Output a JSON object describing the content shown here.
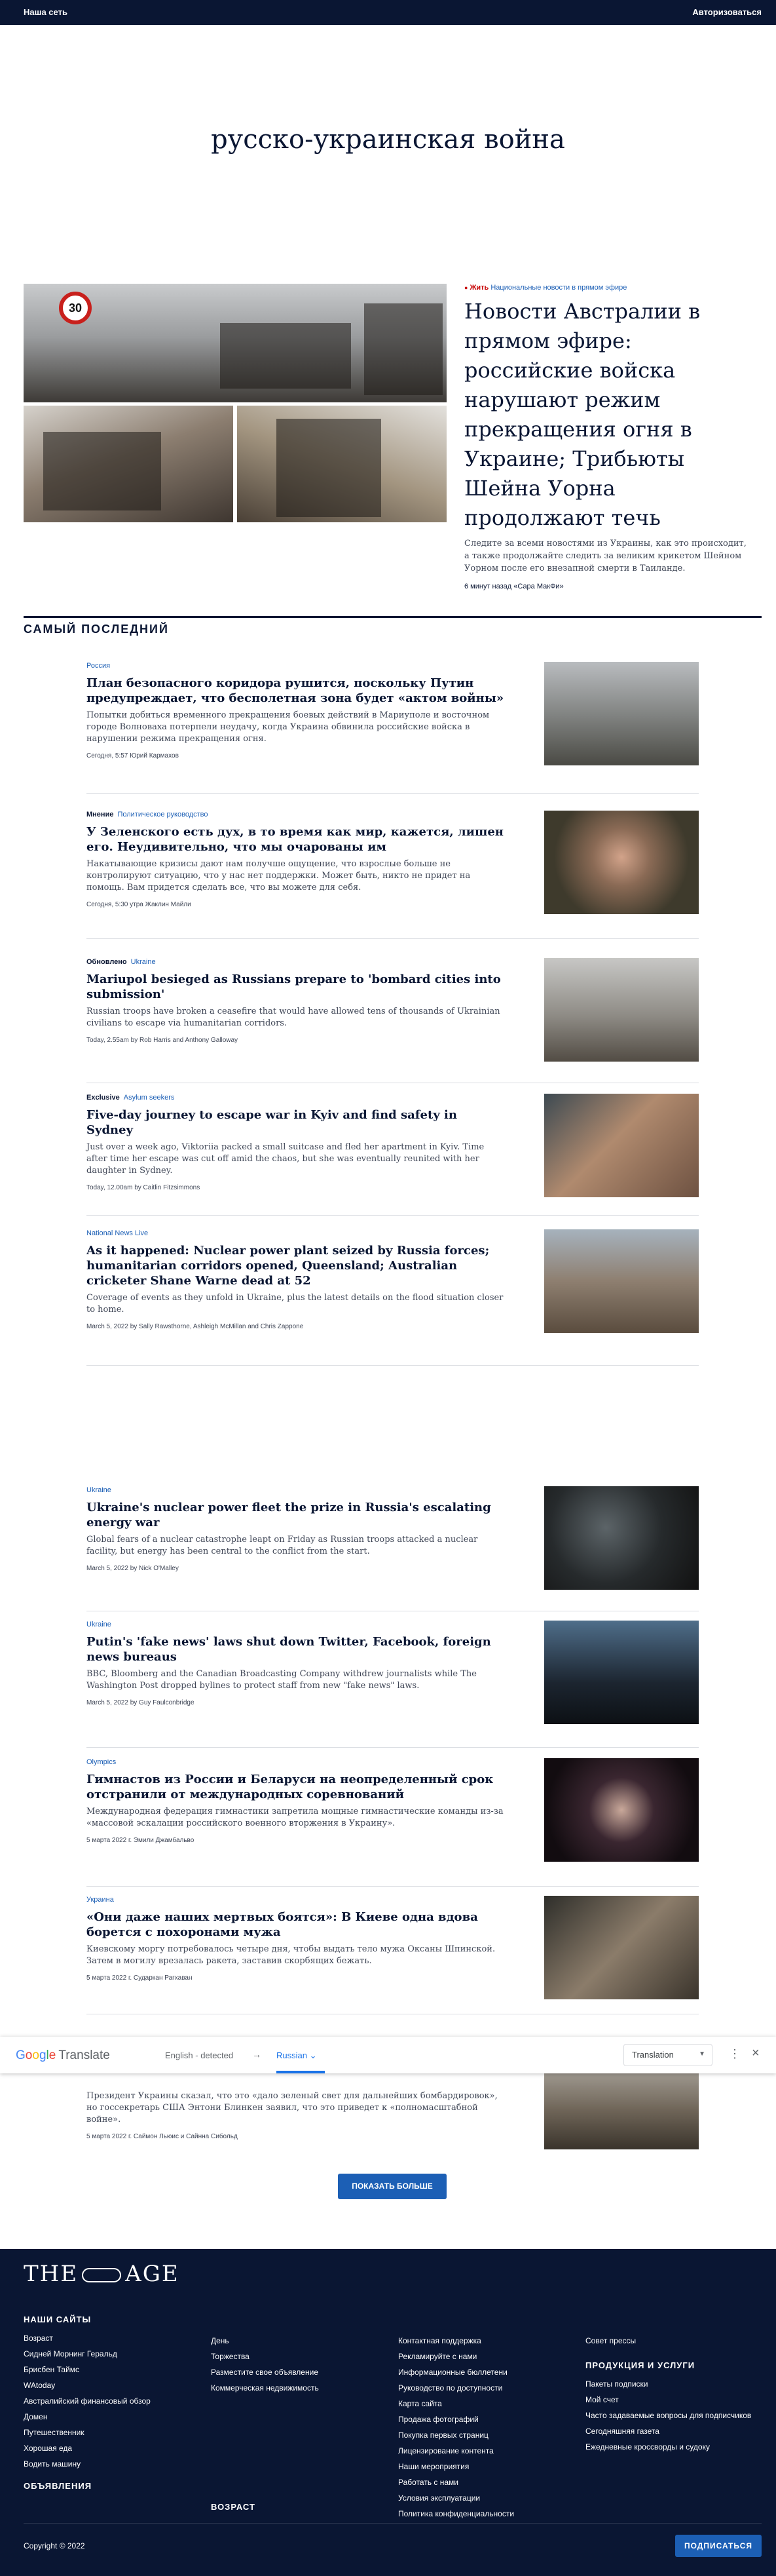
{
  "topbar": {
    "network": "Наша сеть",
    "login": "Авторизоваться"
  },
  "page_title": "русско-украинская война",
  "hero": {
    "tag_live": "Жить",
    "tag_section": "Национальные новости в прямом эфире",
    "headline": "Новости Австралии в прямом эфире: российские войска нарушают режим прекращения огня в Украине; Трибьюты Шейна Уорна продолжают течь",
    "summary": "Следите за всеми новостями из Украины, как это происходит, а также продолжайте следить за великим крикетом Шейном Уорном после его внезапной смерти в Таиланде.",
    "meta": "6 минут назад «Сара МакФи»",
    "sign_text": "30"
  },
  "latest_heading": "САМЫЙ ПОСЛЕДНИЙ",
  "stories": [
    {
      "label": "",
      "section": "Россия",
      "headline": "План безопасного коридора рушится, поскольку Путин предупреждает, что бесполетная зона будет «актом войны»",
      "summary": "Попытки добиться временного прекращения боевых действий в Мариуполе и восточном городе Волноваха потерпели неудачу, когда Украина обвинила российские войска в нарушении режима прекращения огня.",
      "meta": "Сегодня, 5:57 Юрий Кармахов"
    },
    {
      "label": "Мнение",
      "section": "Политическое руководство",
      "headline": "У Зеленского есть дух, в то время как мир, кажется, лишен его. Неудивительно, что мы очарованы им",
      "summary": "Накатывающие кризисы дают нам получше ощущение, что взрослые больше не контролируют ситуацию, что у нас нет поддержки. Может быть, никто не придет на помощь. Вам придется сделать все, что вы можете для себя.",
      "meta": "Сегодня, 5:30 утра Жаклин Майли"
    },
    {
      "label": "Обновлено",
      "section": "Ukraine",
      "headline": "Mariupol besieged as Russians prepare to 'bombard cities into submission'",
      "summary": "Russian troops have broken a ceasefire that would have allowed tens of thousands of Ukrainian civilians to escape via humanitarian corridors.",
      "meta": "Today, 2.55am by Rob Harris and Anthony Galloway"
    },
    {
      "label": "Exclusive",
      "section": "Asylum seekers",
      "headline": "Five-day journey to escape war in Kyiv and find safety in Sydney",
      "summary": "Just over a week ago, Viktoriia packed a small suitcase and fled her apartment in Kyiv. Time after time her escape was cut off amid the chaos, but she was eventually reunited with her daughter in Sydney.",
      "meta": "Today, 12.00am by Caitlin Fitzsimmons"
    },
    {
      "label": "",
      "section": "National News Live",
      "headline": "As it happened: Nuclear power plant seized by Russia forces; humanitarian corridors opened, Queensland; Australian cricketer Shane Warne dead at 52",
      "summary": "Coverage of events as they unfold in Ukraine, plus the latest details on the flood situation closer to home.",
      "meta": "March 5, 2022 by Sally Rawsthorne, Ashleigh McMillan and Chris Zappone"
    },
    {
      "label": "",
      "section": "Ukraine",
      "headline": "Ukraine's nuclear power fleet the prize in Russia's escalating energy war",
      "summary": "Global fears of a nuclear catastrophe leapt on Friday as Russian troops attacked a nuclear facility, but energy has been central to the conflict from the start.",
      "meta": "March 5, 2022 by Nick O'Malley"
    },
    {
      "label": "",
      "section": "Ukraine",
      "headline": "Putin's 'fake news' laws shut down Twitter, Facebook, foreign news bureaus",
      "summary": "BBC, Bloomberg and the Canadian Broadcasting Company withdrew journalists while The Washington Post dropped bylines to protect staff from new \"fake news\" laws.",
      "meta": "March 5, 2022 by Guy Faulconbridge"
    },
    {
      "label": "",
      "section": "Olympics",
      "headline": "Гимнастов из России и Беларуси на неопределенный срок отстранили от международных соревнований",
      "summary": "Международная федерация гимнастики запретила мощные гимнастические команды из-за «массовой эскалации российского военного вторжения в Украину».",
      "meta": "5 марта 2022 г. Эмили Джамбальво"
    },
    {
      "label": "",
      "section": "Украина",
      "headline": "«Они даже наших мертвых боятся»: В Киеве одна вдова борется с похоронами мужа",
      "summary": "Киевскому моргу потребовалось четыре дня, чтобы выдать тело мужа Оксаны Шпинской. Затем в могилу врезалась ракета, заставив скорбящих бежать.",
      "meta": "5 марта 2022 г. Сударкан Рагхаван"
    },
    {
      "label": "",
      "section": "",
      "headline": "",
      "summary": "Президент Украины сказал, что это «дало зеленый свет для дальнейших бомбардировок», но госсекретарь США Энтони Блинкен заявил, что это приведет к «полномасштабной войне».",
      "meta": "5 марта 2022 г. Саймон Льюис и Сайнна Сибольд"
    }
  ],
  "show_more": "ПОКАЗАТЬ БОЛЬШЕ",
  "translate_bar": {
    "logo_google": [
      "G",
      "o",
      "o",
      "g",
      "l",
      "e"
    ],
    "logo_word": "Translate",
    "source_lang": "English - detected",
    "arrow": "→",
    "target_lang": "Russian",
    "mode": "Translation"
  },
  "footer": {
    "logo_left": "THE",
    "logo_right": "AGE",
    "col1_heading": "НАШИ САЙТЫ",
    "col1_items": [
      "Возраст",
      "Сидней Морнинг Геральд",
      "Брисбен Таймс",
      "WAtoday",
      "Австралийский финансовый обзор",
      "Домен",
      "Путешественник",
      "Хорошая еда",
      "Водить машину"
    ],
    "col1_heading2": "ОБЪЯВЛЕНИЯ",
    "col2_items": [
      "День",
      "Торжества",
      "Разместите свое объявление",
      "Коммерческая недвижимость"
    ],
    "col2_heading2": "ВОЗРАСТ",
    "col3_items": [
      "Контактная поддержка",
      "Рекламируйте с нами",
      "Информационные бюллетени",
      "Руководство по доступности",
      "Карта сайта",
      "Продажа фотографий",
      "Покупка первых страниц",
      "Лицензирование контента",
      "Наши мероприятия",
      "Работать с нами",
      "Условия эксплуатации",
      "Политика конфиденциальности"
    ],
    "col4_items_top": [
      "Совет прессы"
    ],
    "col4_heading": "ПРОДУКЦИЯ И УСЛУГИ",
    "col4_items": [
      "Пакеты подписки",
      "Мой счет",
      "Часто задаваемые вопросы для подписчиков",
      "Сегодняшняя газета",
      "Ежедневные кроссворды и судоку"
    ],
    "copyright": "Copyright © 2022",
    "subscribe": "ПОДПИСАТЬСЯ"
  },
  "colors": {
    "navy": "#0a1633",
    "link_blue": "#1c5fb5",
    "live_red": "#c70000"
  }
}
